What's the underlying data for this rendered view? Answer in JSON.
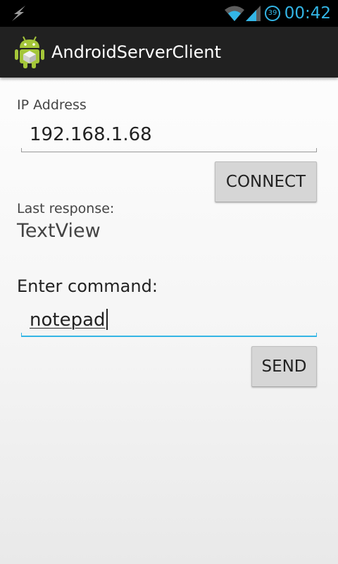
{
  "status_bar": {
    "time": "00:42",
    "battery_level": "39",
    "icons": [
      "usb-debug-icon",
      "wifi-icon",
      "signal-icon",
      "battery-icon"
    ],
    "accent_color": "#33b5e5"
  },
  "action_bar": {
    "title": "AndroidServerClient",
    "icon": "android-robot-icon",
    "background": "#212121"
  },
  "form": {
    "ip_label": "IP Address",
    "ip_value": "192.168.1.68",
    "connect_label": "CONNECT",
    "last_response_label": "Last response:",
    "last_response_value": "TextView",
    "command_label": "Enter command:",
    "command_value": "notepad",
    "send_label": "SEND"
  }
}
